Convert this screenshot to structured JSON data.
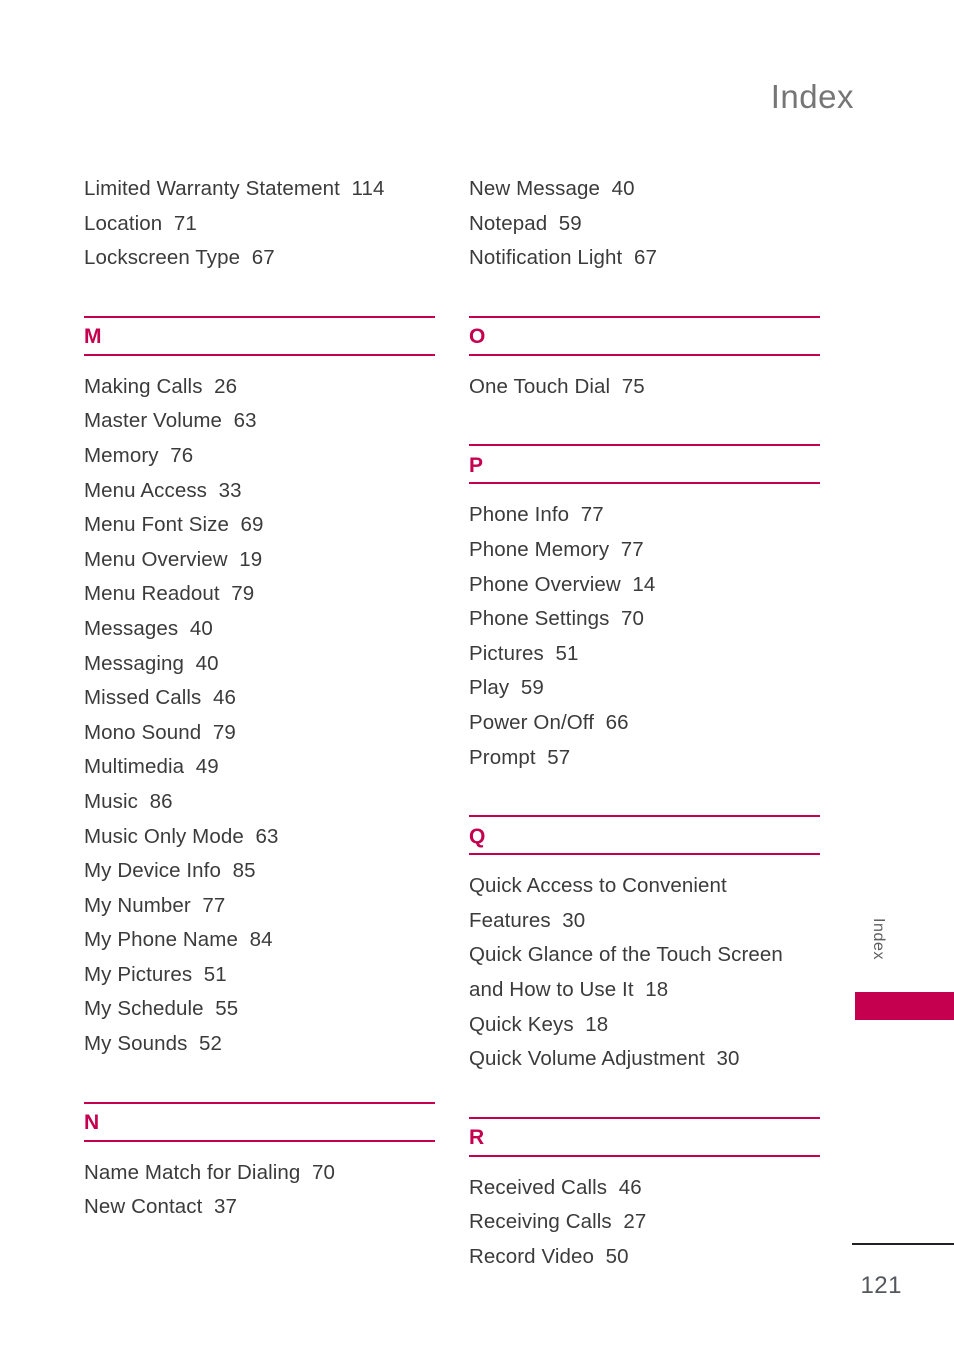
{
  "page": {
    "title": "Index",
    "number": "121",
    "side_tab_label": "Index",
    "accent_color": "#c4004f",
    "text_color": "#3b3b3b",
    "title_color": "#767676"
  },
  "columns": [
    {
      "blocks": [
        {
          "type": "entries",
          "entries": [
            "Limited Warranty Statement  114",
            "Location  71",
            "Lockscreen Type  67"
          ]
        },
        {
          "type": "section",
          "letter": "M",
          "entries": [
            "Making Calls  26",
            "Master Volume  63",
            "Memory  76",
            "Menu Access  33",
            "Menu Font Size  69",
            "Menu Overview  19",
            "Menu Readout  79",
            "Messages  40",
            "Messaging  40",
            "Missed Calls  46",
            "Mono Sound  79",
            "Multimedia  49",
            "Music  86",
            "Music Only Mode  63",
            "My Device Info  85",
            "My Number  77",
            "My Phone Name  84",
            "My Pictures  51",
            "My Schedule  55",
            "My Sounds  52"
          ]
        },
        {
          "type": "section",
          "letter": "N",
          "entries": [
            "Name Match for Dialing  70",
            "New Contact  37"
          ]
        }
      ]
    },
    {
      "blocks": [
        {
          "type": "entries",
          "entries": [
            "New Message  40",
            "Notepad  59",
            "Notification Light  67"
          ]
        },
        {
          "type": "section",
          "letter": "O",
          "entries": [
            "One Touch Dial  75"
          ]
        },
        {
          "type": "section",
          "letter": "P",
          "entries": [
            "Phone Info  77",
            "Phone Memory  77",
            "Phone Overview  14",
            "Phone Settings  70",
            "Pictures  51",
            "Play  59",
            "Power On/Off  66",
            "Prompt  57"
          ]
        },
        {
          "type": "section",
          "letter": "Q",
          "entries": [
            "Quick Access to Convenient\nFeatures  30",
            "Quick Glance of the Touch Screen\nand How to Use It  18",
            "Quick Keys  18",
            "Quick Volume Adjustment  30"
          ]
        },
        {
          "type": "section",
          "letter": "R",
          "entries": [
            "Received Calls  46",
            "Receiving Calls  27",
            "Record Video  50"
          ]
        }
      ]
    }
  ]
}
